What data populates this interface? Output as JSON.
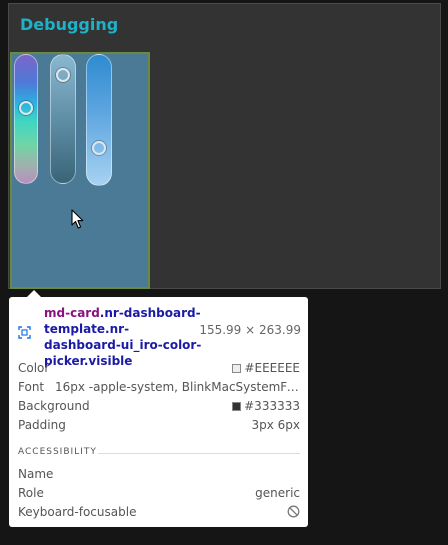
{
  "panel": {
    "title": "Debugging"
  },
  "color_picker": {
    "hue_level": 0.4,
    "saturation_level": 0.1,
    "lightness_level": 0.75
  },
  "inspector": {
    "selector_tag": "md-card",
    "selector_classes": ".nr-dashboard-template.nr-dashboard-ui_iro-color-picker.visible",
    "size": "155.99 × 263.99",
    "color_label": "Color",
    "color_value": "#EEEEEE",
    "color_swatch": "#EEEEEE",
    "font_label": "Font",
    "font_value": "16px -apple-system, BlinkMacSystemFon…",
    "background_label": "Background",
    "background_value": "#333333",
    "background_swatch": "#333333",
    "padding_label": "Padding",
    "padding_value": "3px 6px",
    "accessibility_heading": "ACCESSIBILITY",
    "name_label": "Name",
    "name_value": "",
    "role_label": "Role",
    "role_value": "generic",
    "focusable_label": "Keyboard-focusable",
    "focusable_icon": "not-allowed-icon"
  }
}
